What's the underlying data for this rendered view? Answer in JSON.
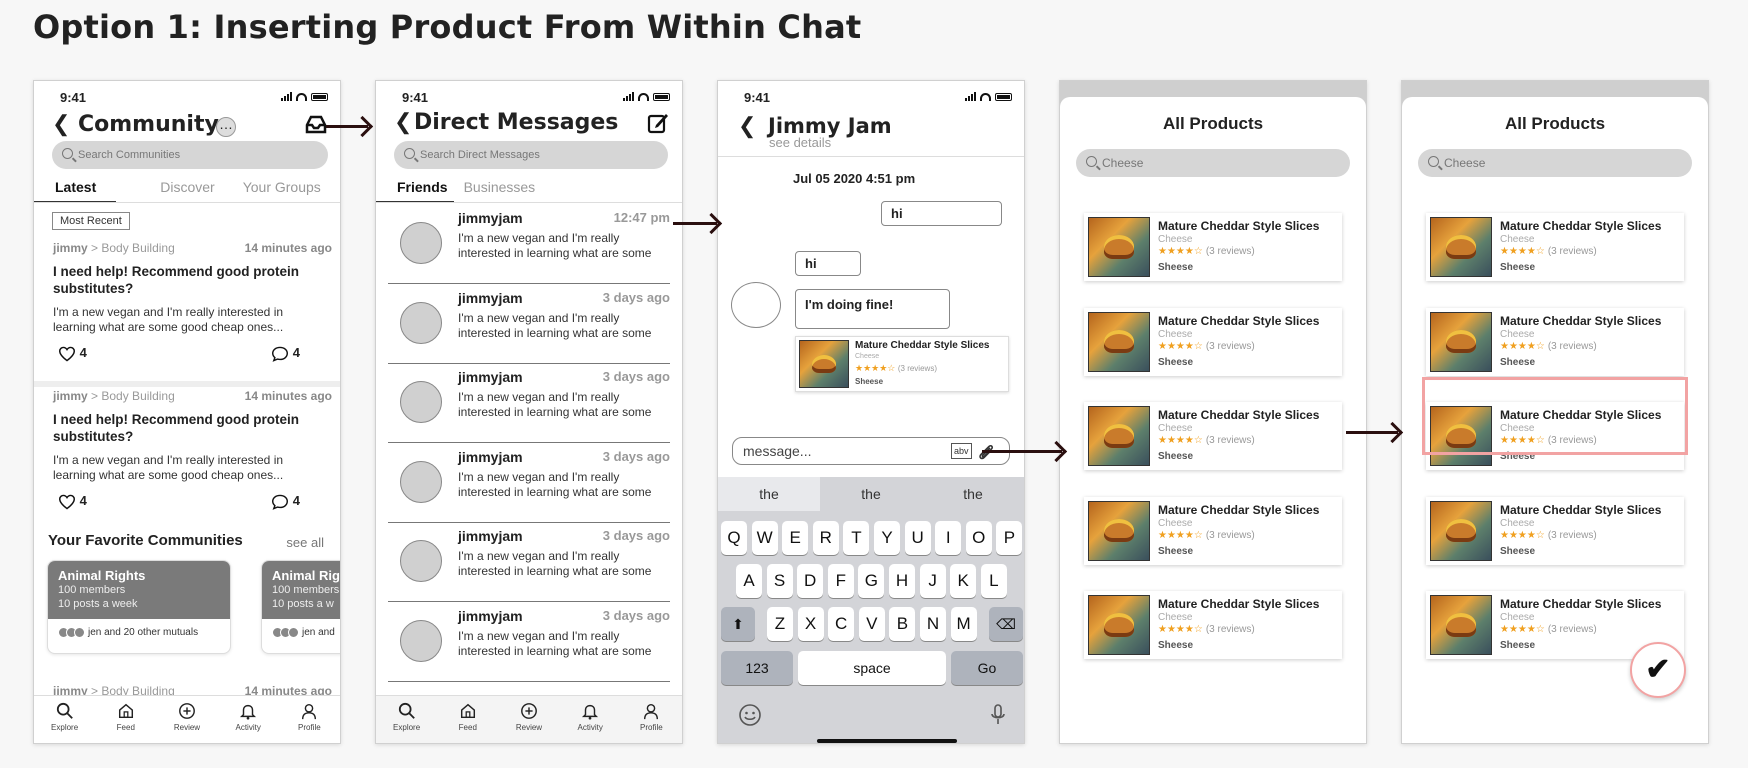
{
  "page_title": "Option 1: Inserting Product From Within Chat",
  "status_time": "9:41",
  "community": {
    "title": "Community",
    "search_placeholder": "Search Communities",
    "tabs": [
      "Latest",
      "Discover",
      "Your Groups"
    ],
    "filter_pill": "Most Recent",
    "posts": [
      {
        "user": "jimmy",
        "sep": " > ",
        "group": "Body Building",
        "ago": "14 minutes ago",
        "title": "I need help! Recommend good protein substitutes?",
        "body": "I'm a new vegan and I'm really interested in learning what are some good cheap ones...",
        "likes": "4",
        "comments": "4"
      },
      {
        "user": "jimmy",
        "sep": " > ",
        "group": "Body Building",
        "ago": "14 minutes ago",
        "title": "I need help! Recommend good protein substitutes?",
        "body": "I'm a new vegan and I'm really interested in learning what are some good cheap ones...",
        "likes": "4",
        "comments": "4"
      },
      {
        "user": "jimmy",
        "sep": " > ",
        "group": "Body Building",
        "ago": "14 minutes ago"
      }
    ],
    "fav_title": "Your Favorite Communities",
    "see_all": "see all",
    "cards": [
      {
        "name": "Animal Rights",
        "members": "100 members",
        "posts": "10 posts a week",
        "mutuals": "jen and 20 other mutuals"
      },
      {
        "name": "Animal Rig",
        "members": "100 members",
        "posts": "10 posts a w",
        "mutuals": "jen and"
      }
    ]
  },
  "nav": [
    "Explore",
    "Feed",
    "Review",
    "Activity",
    "Profile"
  ],
  "dms": {
    "title": "Direct Messages",
    "search_placeholder": "Search Direct Messages",
    "tabs": [
      "Friends",
      "Businesses"
    ],
    "rows": [
      {
        "name": "jimmyjam",
        "time": "12:47 pm",
        "preview": "I'm a new vegan and I'm really interested in learning what are some"
      },
      {
        "name": "jimmyjam",
        "time": "3 days ago",
        "preview": "I'm a new vegan and I'm really interested in learning what are some"
      },
      {
        "name": "jimmyjam",
        "time": "3 days ago",
        "preview": "I'm a new vegan and I'm really interested in learning what are some"
      },
      {
        "name": "jimmyjam",
        "time": "3 days ago",
        "preview": "I'm a new vegan and I'm really interested in learning what are some"
      },
      {
        "name": "jimmyjam",
        "time": "3 days ago",
        "preview": "I'm a new vegan and I'm really interested in learning what are some"
      },
      {
        "name": "jimmyjam",
        "time": "3 days ago",
        "preview": "I'm a new vegan and I'm really interested in learning what are some"
      }
    ]
  },
  "chat": {
    "title": "Jimmy Jam",
    "subtitle": "see details",
    "date": "Jul 05 2020 4:51 pm",
    "msg_out": "hi",
    "msg_in1": "hi",
    "msg_in2": "I'm doing fine!",
    "shared_product": {
      "name": "Mature Cheddar Style Slices",
      "category": "Cheese",
      "stars": "★★★★☆",
      "reviews": "(3 reviews)",
      "store": "Sheese"
    },
    "input_placeholder": "message...",
    "abv": "abv",
    "suggestions": [
      "the",
      "the",
      "the"
    ],
    "row1": [
      "Q",
      "W",
      "E",
      "R",
      "T",
      "Y",
      "U",
      "I",
      "O",
      "P"
    ],
    "row2": [
      "A",
      "S",
      "D",
      "F",
      "G",
      "H",
      "J",
      "K",
      "L"
    ],
    "row3": [
      "Z",
      "X",
      "C",
      "V",
      "B",
      "N",
      "M"
    ],
    "key_123": "123",
    "key_space": "space",
    "key_go": "Go"
  },
  "products": {
    "title": "All Products",
    "search_value": "Cheese",
    "items": [
      {
        "name": "Mature Cheddar Style Slices",
        "category": "Cheese",
        "stars": "★★★★☆",
        "reviews": "(3 reviews)",
        "store": "Sheese"
      },
      {
        "name": "Mature Cheddar Style Slices",
        "category": "Cheese",
        "stars": "★★★★☆",
        "reviews": "(3 reviews)",
        "store": "Sheese"
      },
      {
        "name": "Mature Cheddar Style Slices",
        "category": "Cheese",
        "stars": "★★★★☆",
        "reviews": "(3 reviews)",
        "store": "Sheese"
      },
      {
        "name": "Mature Cheddar Style Slices",
        "category": "Cheese",
        "stars": "★★★★☆",
        "reviews": "(3 reviews)",
        "store": "Sheese"
      },
      {
        "name": "Mature Cheddar Style Slices",
        "category": "Cheese",
        "stars": "★★★★☆",
        "reviews": "(3 reviews)",
        "store": "Sheese"
      }
    ],
    "check": "✔"
  },
  "colors": {
    "highlight": "#f2a3a3",
    "star": "#f0a020",
    "arrow": "#2a0f0f"
  }
}
